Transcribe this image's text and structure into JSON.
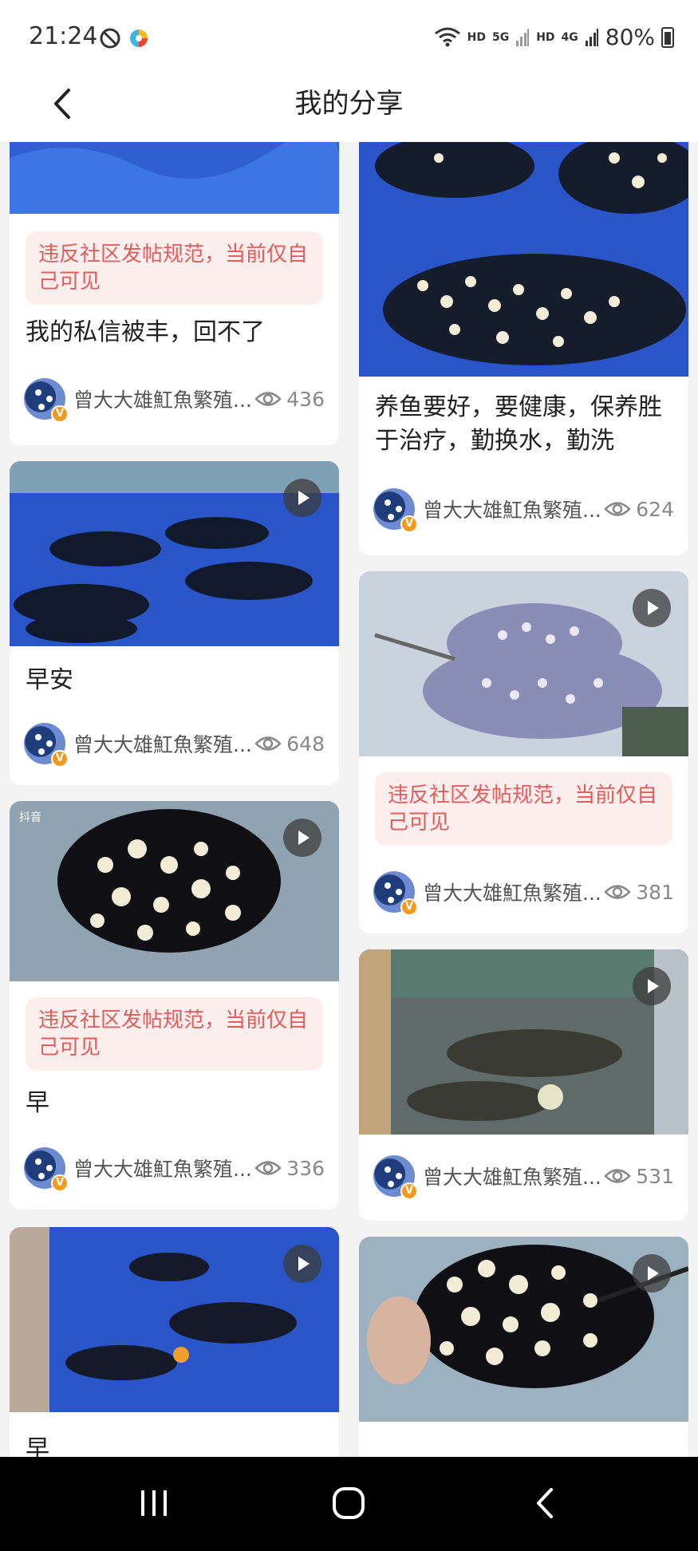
{
  "status_bar": {
    "time": "21:24",
    "signal_labels": [
      "HD",
      "5G",
      "HD",
      "4G"
    ],
    "battery": "80%"
  },
  "header": {
    "title": "我的分享"
  },
  "violation_text": "违反社区发帖规范，当前仅自己可见",
  "author_name": "曾大大雄魟魚繁殖...",
  "cards": [
    {
      "title": "我的私信被丰，回不了",
      "views": "436",
      "violation": true,
      "video": false
    },
    {
      "title": "早安",
      "views": "648",
      "violation": false,
      "video": true
    },
    {
      "title": "早",
      "views": "336",
      "violation": true,
      "video": true,
      "watermark": "抖音"
    },
    {
      "title": "早",
      "views": "",
      "violation": false,
      "video": true
    },
    {
      "title": "养鱼要好，要健康，保养胜于治疗，勤换水，勤洗",
      "views": "624",
      "violation": false,
      "video": false
    },
    {
      "title": "",
      "views": "381",
      "violation": true,
      "video": true
    },
    {
      "title": "",
      "views": "531",
      "violation": false,
      "video": true
    },
    {
      "title": "",
      "views": "",
      "violation": false,
      "video": true
    }
  ],
  "colors": {
    "violation_text": "#e25c5c",
    "violation_bg": "#fdeeee",
    "badge": "#f39a1e",
    "water": "#2f5fd0"
  },
  "icons": [
    "back-icon",
    "eye-icon",
    "play-icon",
    "menu-icon",
    "home-icon",
    "nav-back-icon",
    "wifi-icon",
    "battery-icon"
  ]
}
